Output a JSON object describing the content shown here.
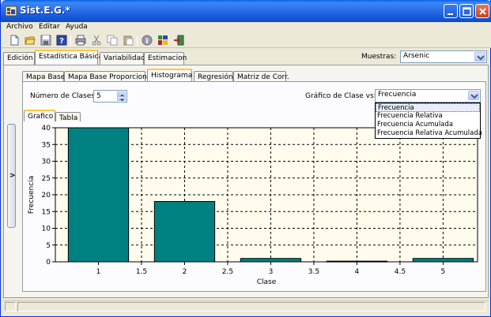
{
  "window": {
    "title": "Sist.E.G.*"
  },
  "menu": {
    "items": [
      "Archivo",
      "Editar",
      "Ayuda"
    ]
  },
  "toolbar": {
    "icons": [
      "new-file-icon",
      "open-folder-icon",
      "save-icon",
      "help-icon",
      "print-icon",
      "cut-icon",
      "copy-icon",
      "paste-icon",
      "info-icon",
      "grid-icon",
      "exit-icon"
    ]
  },
  "main_tabs": [
    "Edición",
    "Estadística Básica",
    "Variabilidad",
    "Estimacion"
  ],
  "muestras": {
    "label": "Muestras:",
    "value": "Arsenic"
  },
  "sub_tabs": [
    "Mapa Base",
    "Mapa Base Proporcional",
    "Histograma",
    "Regresión",
    "Matriz de Corr."
  ],
  "controls": {
    "num_clases_label": "Número de Clases:",
    "num_clases_value": "5",
    "grafico_vs_label": "Gráfico de Clase vs:",
    "grafico_vs_value": "Frecuencia",
    "grafico_vs_options": [
      "Frecuencia",
      "Frecuencia Relativa",
      "Frecuencia Acumulada",
      "Frecuencia Relativa Acumulada"
    ]
  },
  "graph_tabs": [
    "Grafico",
    "Tabla"
  ],
  "side_handle": {
    "label": ">"
  },
  "colors": {
    "bar": "#008080",
    "accent": "#FFC73C",
    "title_bar": "#0A5FE8"
  },
  "chart_data": {
    "type": "bar",
    "x": [
      1,
      2,
      3,
      4,
      5
    ],
    "values": [
      40,
      18,
      1,
      0.2,
      1
    ],
    "xlabel": "Clase",
    "ylabel": "Frecuencia",
    "xlim": [
      0.5,
      5.4
    ],
    "ylim": [
      0,
      40
    ],
    "xticks": [
      "1",
      "1.5",
      "2",
      "2.5",
      "3",
      "3.5",
      "4",
      "4.5",
      "5"
    ],
    "yticks": [
      "0",
      "5",
      "10",
      "15",
      "20",
      "25",
      "30",
      "35",
      "40"
    ],
    "grid": true
  }
}
